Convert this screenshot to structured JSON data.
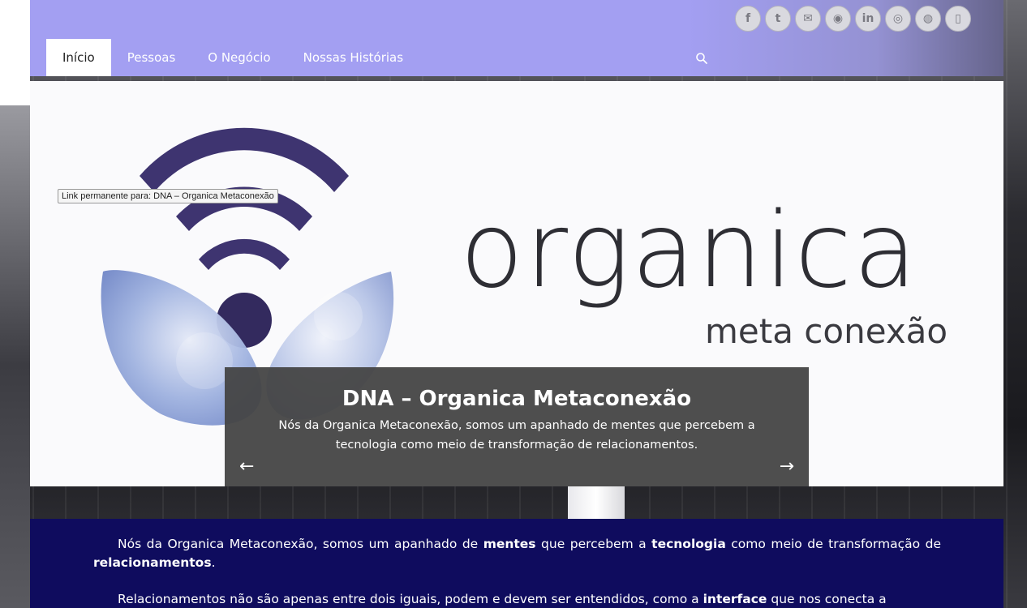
{
  "nav": {
    "items": [
      {
        "label": "Início",
        "active": true
      },
      {
        "label": "Pessoas",
        "active": false
      },
      {
        "label": "O Negócio",
        "active": false
      },
      {
        "label": "Nossas Histórias",
        "active": false
      }
    ]
  },
  "social": [
    {
      "name": "facebook-icon",
      "glyph": "f"
    },
    {
      "name": "twitter-icon",
      "glyph": "t"
    },
    {
      "name": "email-icon",
      "glyph": "✉"
    },
    {
      "name": "github-icon",
      "glyph": "◉"
    },
    {
      "name": "linkedin-icon",
      "glyph": "in"
    },
    {
      "name": "instagram-icon",
      "glyph": "◎"
    },
    {
      "name": "website-icon",
      "glyph": "◍"
    },
    {
      "name": "phone-icon",
      "glyph": "▯"
    }
  ],
  "slider": {
    "tooltip": "Link permanente para: DNA – Organica Metaconexão",
    "brand_word": "organica",
    "brand_sub": "meta conexão",
    "caption_title": "DNA – Organica Metaconexão",
    "caption_text": "Nós da Organica Metaconexão, somos um apanhado de mentes que percebem a tecnologia como meio de transformação de relacionamentos.",
    "prev_arrow": "←",
    "next_arrow": "→"
  },
  "content": {
    "p1_a": "Nós da Organica Metaconexão, somos um apanhado de ",
    "p1_b1": "mentes",
    "p1_c": " que percebem a ",
    "p1_b2": "tecnologia",
    "p1_d": " como meio de transformação de ",
    "p1_b3": "relacionamentos",
    "p1_e": ".",
    "p2_a": "Relacionamentos não são apenas entre dois iguais, podem e devem ser entendidos, como a ",
    "p2_b1": "interface",
    "p2_c": " que nos conecta a"
  },
  "colors": {
    "header": "#a39ff2",
    "content_bg": "#0f0c5e",
    "caption_bg": "#444444"
  }
}
